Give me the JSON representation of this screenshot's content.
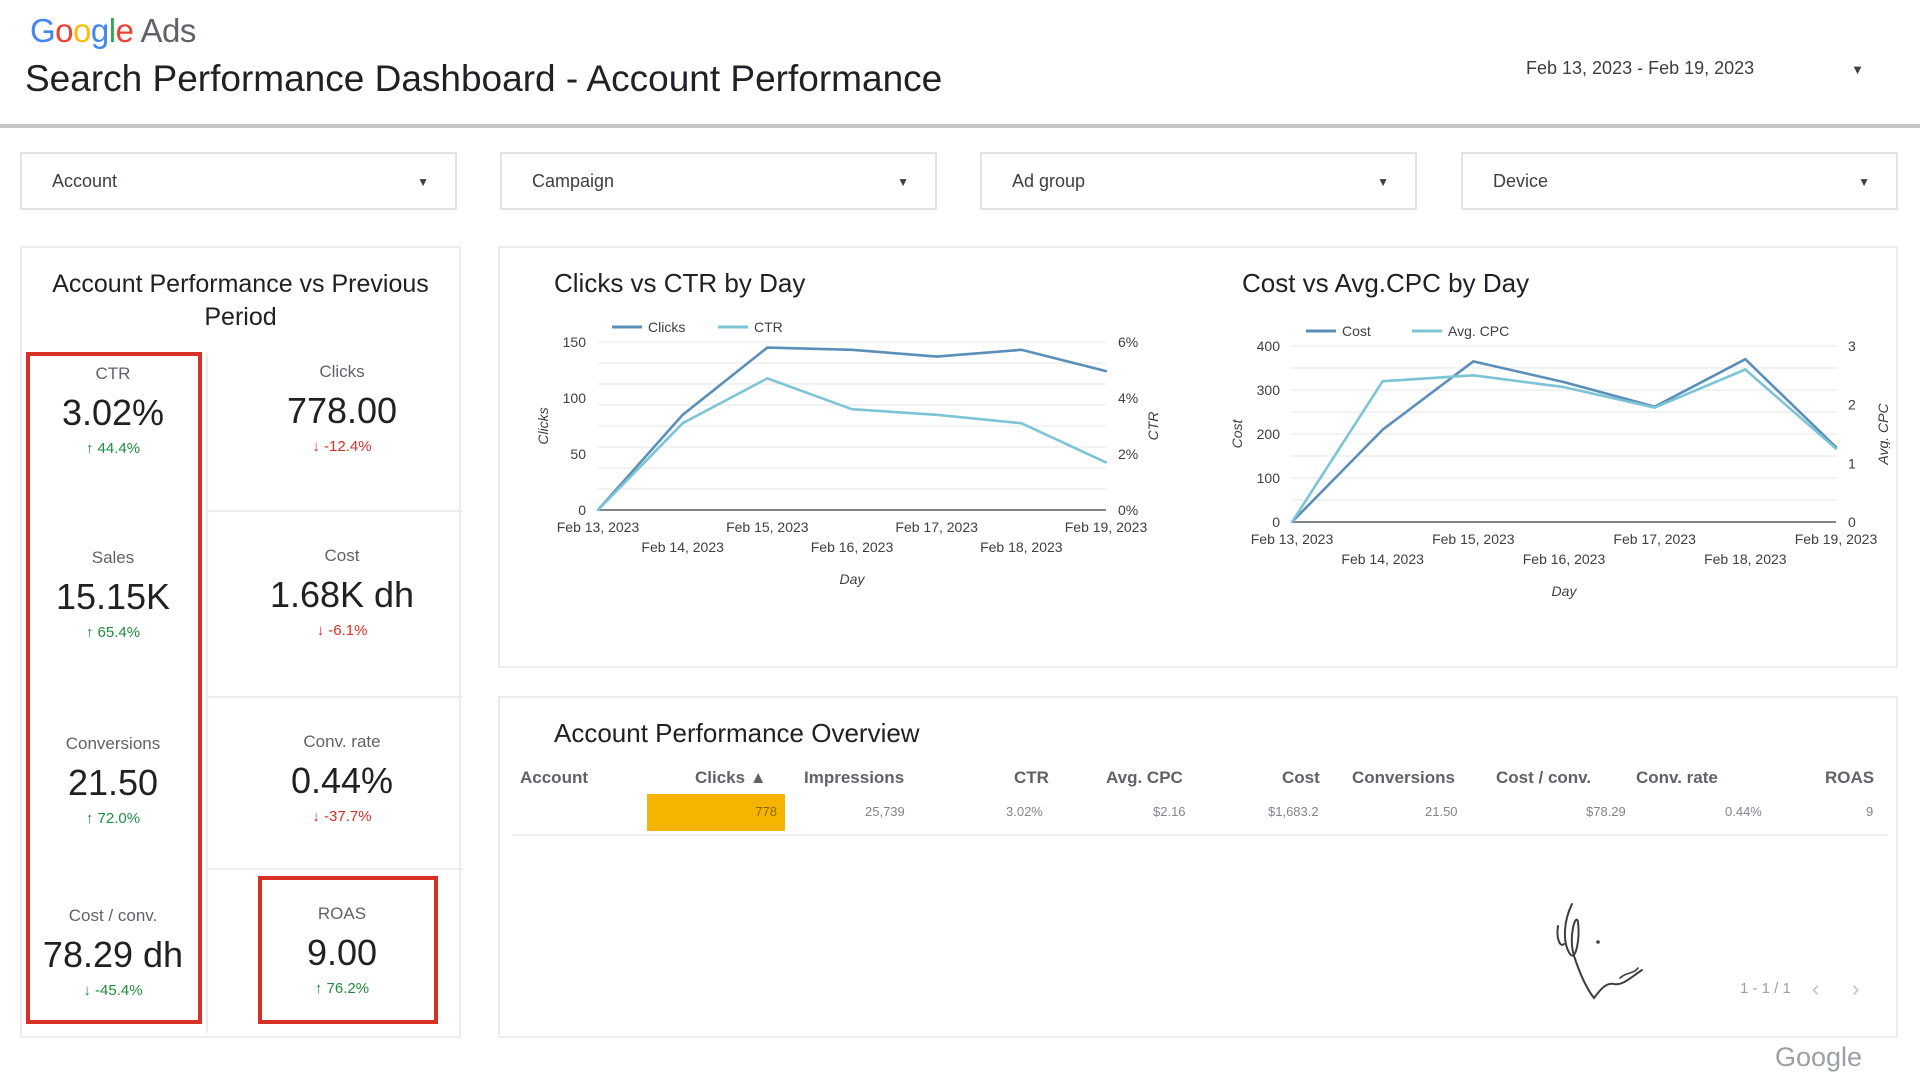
{
  "header": {
    "logo_google": "Google",
    "logo_ads": "Ads",
    "title": "Search Performance Dashboard - Account Performance",
    "date_range": "Feb 13, 2023 - Feb 19, 2023"
  },
  "filters": [
    {
      "label": "Account"
    },
    {
      "label": "Campaign"
    },
    {
      "label": "Ad group"
    },
    {
      "label": "Device"
    }
  ],
  "kpi_panel": {
    "title": "Account Performance vs Previous Period",
    "cards": [
      {
        "label": "CTR",
        "value": "3.02%",
        "delta": "↑ 44.4%",
        "trend": "up",
        "highlighted": true
      },
      {
        "label": "Clicks",
        "value": "778.00",
        "delta": "↓ -12.4%",
        "trend": "down",
        "highlighted": false
      },
      {
        "label": "Sales",
        "value": "15.15K",
        "delta": "↑ 65.4%",
        "trend": "up",
        "highlighted": true
      },
      {
        "label": "Cost",
        "value": "1.68K dh",
        "delta": "↓ -6.1%",
        "trend": "down",
        "highlighted": false
      },
      {
        "label": "Conversions",
        "value": "21.50",
        "delta": "↑ 72.0%",
        "trend": "up",
        "highlighted": true
      },
      {
        "label": "Conv. rate",
        "value": "0.44%",
        "delta": "↓ -37.7%",
        "trend": "down",
        "highlighted": false
      },
      {
        "label": "Cost / conv.",
        "value": "78.29 dh",
        "delta": "↓ -45.4%",
        "trend": "down-good",
        "highlighted": true
      },
      {
        "label": "ROAS",
        "value": "9.00",
        "delta": "↑ 76.2%",
        "trend": "up",
        "highlighted": true
      }
    ],
    "highlight_color": "#d93025"
  },
  "colors": {
    "series_primary": "#5b8fb9",
    "series_secondary": "#7cc4d6",
    "positive": "#1e8e3e",
    "negative": "#d93025",
    "table_bar": "#f4b400"
  },
  "chart_data": [
    {
      "type": "line",
      "title": "Clicks vs CTR by Day",
      "xlabel": "Day",
      "ylabel": "Clicks",
      "y2label": "CTR",
      "x": [
        "Feb 13, 2023",
        "Feb 14, 2023",
        "Feb 15, 2023",
        "Feb 16, 2023",
        "Feb 17, 2023",
        "Feb 18, 2023",
        "Feb 19, 2023"
      ],
      "ylim": [
        0,
        150
      ],
      "y2lim": [
        0,
        6
      ],
      "yticks": [
        0,
        50,
        100,
        150
      ],
      "y2ticks": [
        "0%",
        "2%",
        "4%",
        "6%"
      ],
      "legend": "top-left",
      "grid": true,
      "series": [
        {
          "name": "Clicks",
          "axis": "left",
          "values": [
            0,
            85,
            145,
            143,
            137,
            143,
            124
          ]
        },
        {
          "name": "CTR",
          "axis": "right",
          "values": [
            0,
            3.1,
            4.7,
            3.6,
            3.4,
            3.1,
            1.7
          ]
        }
      ]
    },
    {
      "type": "line",
      "title": "Cost vs Avg.CPC by Day",
      "xlabel": "Day",
      "ylabel": "Cost",
      "y2label": "Avg. CPC",
      "x": [
        "Feb 13, 2023",
        "Feb 14, 2023",
        "Feb 15, 2023",
        "Feb 16, 2023",
        "Feb 17, 2023",
        "Feb 18, 2023",
        "Feb 19, 2023"
      ],
      "ylim": [
        0,
        400
      ],
      "y2lim": [
        0,
        3
      ],
      "yticks": [
        0,
        100,
        200,
        300,
        400
      ],
      "y2ticks": [
        "0",
        "1",
        "2",
        "3"
      ],
      "legend": "top-left",
      "grid": true,
      "series": [
        {
          "name": "Cost",
          "axis": "left",
          "values": [
            0,
            210,
            365,
            318,
            262,
            370,
            170
          ]
        },
        {
          "name": "Avg. CPC",
          "axis": "right",
          "values": [
            0,
            2.4,
            2.5,
            2.3,
            1.95,
            2.6,
            1.25
          ]
        }
      ]
    }
  ],
  "table": {
    "title": "Account Performance Overview",
    "columns": [
      "Account",
      "Clicks ▲",
      "Impressions",
      "CTR",
      "Avg. CPC",
      "Cost",
      "Conversions",
      "Cost / conv.",
      "Conv. rate",
      "ROAS"
    ],
    "rows": [
      [
        "",
        "778",
        "25,739",
        "3.02%",
        "$2.16",
        "$1,683.2",
        "21.50",
        "$78.29",
        "0.44%",
        "9"
      ]
    ],
    "pager": "1 - 1 / 1",
    "prev": "‹",
    "next": "›"
  },
  "footer": {
    "logo": "Google"
  }
}
